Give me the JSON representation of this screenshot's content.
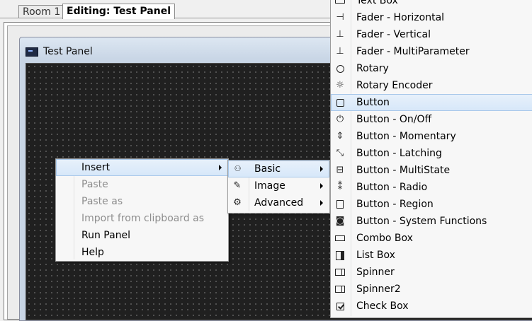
{
  "tabs": [
    {
      "label": "Room 1",
      "active": false
    },
    {
      "label": "Editing: Test Panel",
      "active": true
    }
  ],
  "panel": {
    "title": "Test Panel"
  },
  "context_menu": {
    "items": [
      {
        "label": "Insert",
        "disabled": false,
        "submenu": true,
        "highlighted": true
      },
      {
        "label": "Paste",
        "disabled": true
      },
      {
        "label": "Paste as",
        "disabled": true
      },
      {
        "label": "Import from clipboard as",
        "disabled": true
      },
      {
        "label": "Run Panel",
        "disabled": false
      },
      {
        "label": "Help",
        "disabled": false
      }
    ]
  },
  "insert_menu": {
    "items": [
      {
        "label": "Basic",
        "icon": "basic-controls-icon",
        "highlighted": true
      },
      {
        "label": "Image",
        "icon": "image-icon"
      },
      {
        "label": "Advanced",
        "icon": "advanced-gear-icon"
      }
    ]
  },
  "basic_menu": {
    "items": [
      {
        "label": "Text Box",
        "icon": "text-box-icon"
      },
      {
        "label": "Fader - Horizontal",
        "icon": "fader-horizontal-icon"
      },
      {
        "label": "Fader - Vertical",
        "icon": "fader-vertical-icon"
      },
      {
        "label": "Fader - MultiParameter",
        "icon": "fader-multiparameter-icon"
      },
      {
        "label": "Rotary",
        "icon": "rotary-icon"
      },
      {
        "label": "Rotary Encoder",
        "icon": "rotary-encoder-icon"
      },
      {
        "label": "Button",
        "icon": "button-icon",
        "highlighted": true
      },
      {
        "label": "Button - On/Off",
        "icon": "button-onoff-icon"
      },
      {
        "label": "Button - Momentary",
        "icon": "button-momentary-icon"
      },
      {
        "label": "Button - Latching",
        "icon": "button-latching-icon"
      },
      {
        "label": "Button - MultiState",
        "icon": "button-multistate-icon"
      },
      {
        "label": "Button - Radio",
        "icon": "button-radio-icon"
      },
      {
        "label": "Button - Region",
        "icon": "button-region-icon"
      },
      {
        "label": "Button - System Functions",
        "icon": "button-system-functions-icon"
      },
      {
        "label": "Combo Box",
        "icon": "combo-box-icon"
      },
      {
        "label": "List Box",
        "icon": "list-box-icon"
      },
      {
        "label": "Spinner",
        "icon": "spinner-icon"
      },
      {
        "label": "Spinner2",
        "icon": "spinner2-icon"
      },
      {
        "label": "Check Box",
        "icon": "check-box-icon"
      }
    ]
  },
  "colors": {
    "highlight_bg": "#d6e7f9",
    "highlight_border": "#a8c8ea",
    "canvas_bg": "#202020",
    "disabled_text": "#8d8d8d"
  }
}
